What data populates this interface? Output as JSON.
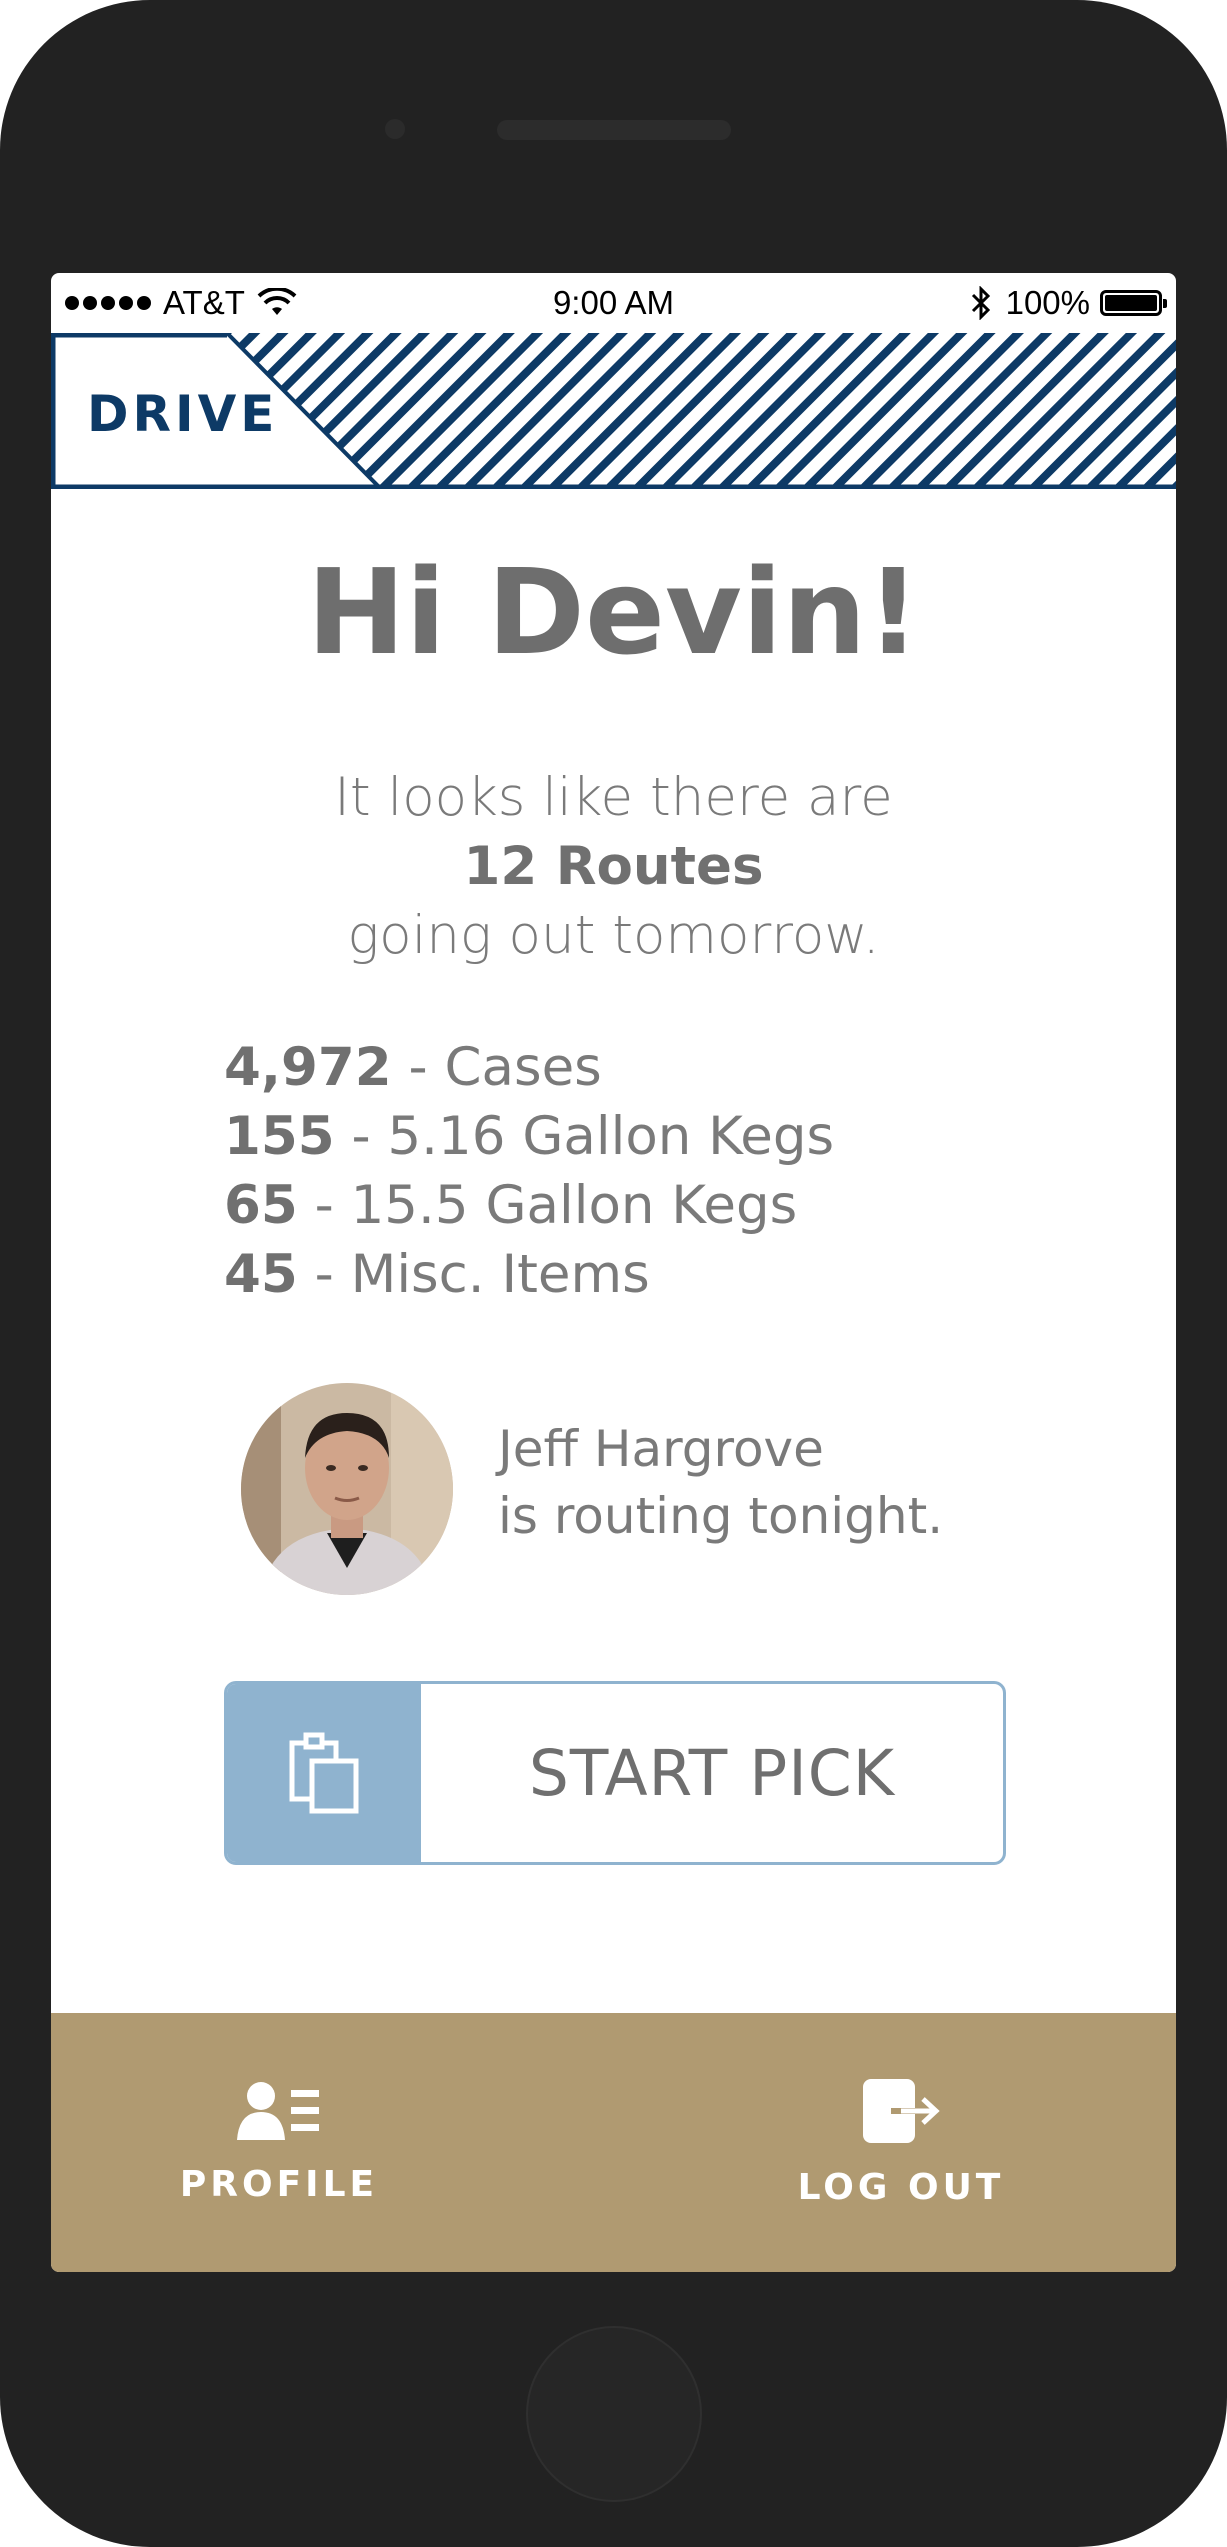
{
  "status_bar": {
    "carrier": "AT&T",
    "time": "9:00 AM",
    "battery": "100%",
    "signal_icon": "signal-dots-icon",
    "wifi_icon": "wifi-icon",
    "bluetooth_icon": "bluetooth-icon",
    "battery_icon": "battery-icon"
  },
  "header": {
    "brand": "DRIVE",
    "brand_color": "#0d3a66"
  },
  "main": {
    "greeting": "Hi Devin!",
    "intro_line1": "It looks like there are",
    "intro_routes": "12 Routes",
    "intro_line3": "going out tomorrow.",
    "stats": [
      {
        "value": "4,972",
        "label": " - Cases"
      },
      {
        "value": "155",
        "label": " - 5.16 Gallon Kegs"
      },
      {
        "value": "65",
        "label": " - 15.5 Gallon Kegs"
      },
      {
        "value": "45",
        "label": " - Misc. Items"
      }
    ],
    "router_name": "Jeff Hargrove",
    "router_status": "is routing tonight.",
    "start_button": {
      "label": "START PICK",
      "icon": "clipboard-icon",
      "accent": "#8fb3cf"
    }
  },
  "bottom_nav": {
    "background": "#b09a71",
    "profile_label": "PROFILE",
    "profile_icon": "profile-icon",
    "logout_label": "LOG OUT",
    "logout_icon": "logout-icon"
  }
}
